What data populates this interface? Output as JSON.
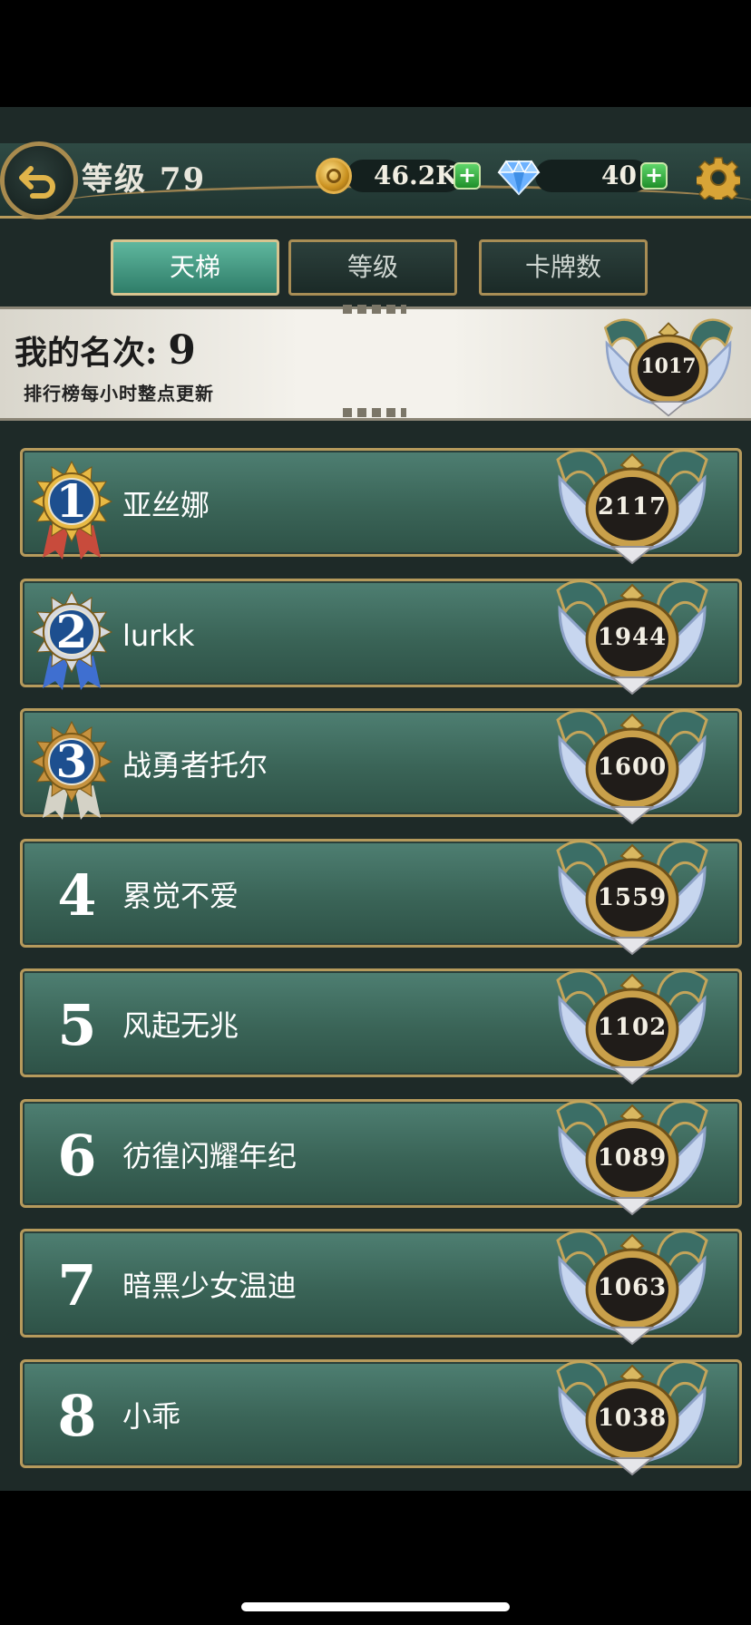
{
  "header": {
    "level_label": "等级 79",
    "coins": "46.2K",
    "gems": "40"
  },
  "tabs": [
    {
      "label": "天梯",
      "active": true
    },
    {
      "label": "等级",
      "active": false
    },
    {
      "label": "卡牌数",
      "active": false
    }
  ],
  "my_rank": {
    "label": "我的名次:",
    "rank": "9",
    "note": "排行榜每小时整点更新",
    "score": "1017"
  },
  "leaderboard": [
    {
      "rank": "1",
      "name": "亚丝娜",
      "score": "2117",
      "medal": "gold"
    },
    {
      "rank": "2",
      "name": "lurkk",
      "score": "1944",
      "medal": "silver"
    },
    {
      "rank": "3",
      "name": "战勇者托尔",
      "score": "1600",
      "medal": "bronze"
    },
    {
      "rank": "4",
      "name": "累觉不爱",
      "score": "1559"
    },
    {
      "rank": "5",
      "name": "风起无兆",
      "score": "1102"
    },
    {
      "rank": "6",
      "name": "彷徨闪耀年纪",
      "score": "1089"
    },
    {
      "rank": "7",
      "name": "暗黑少女温迪",
      "score": "1063"
    },
    {
      "rank": "8",
      "name": "小乖",
      "score": "1038"
    }
  ],
  "colors": {
    "row_bg": "#3a6457",
    "border_gold": "#b69a5c",
    "tab_active": "#4a9e86"
  },
  "icons": [
    "back-arrow-icon",
    "coin-icon",
    "plus-icon",
    "diamond-icon",
    "gear-icon",
    "medal-icon",
    "crest-icon"
  ]
}
